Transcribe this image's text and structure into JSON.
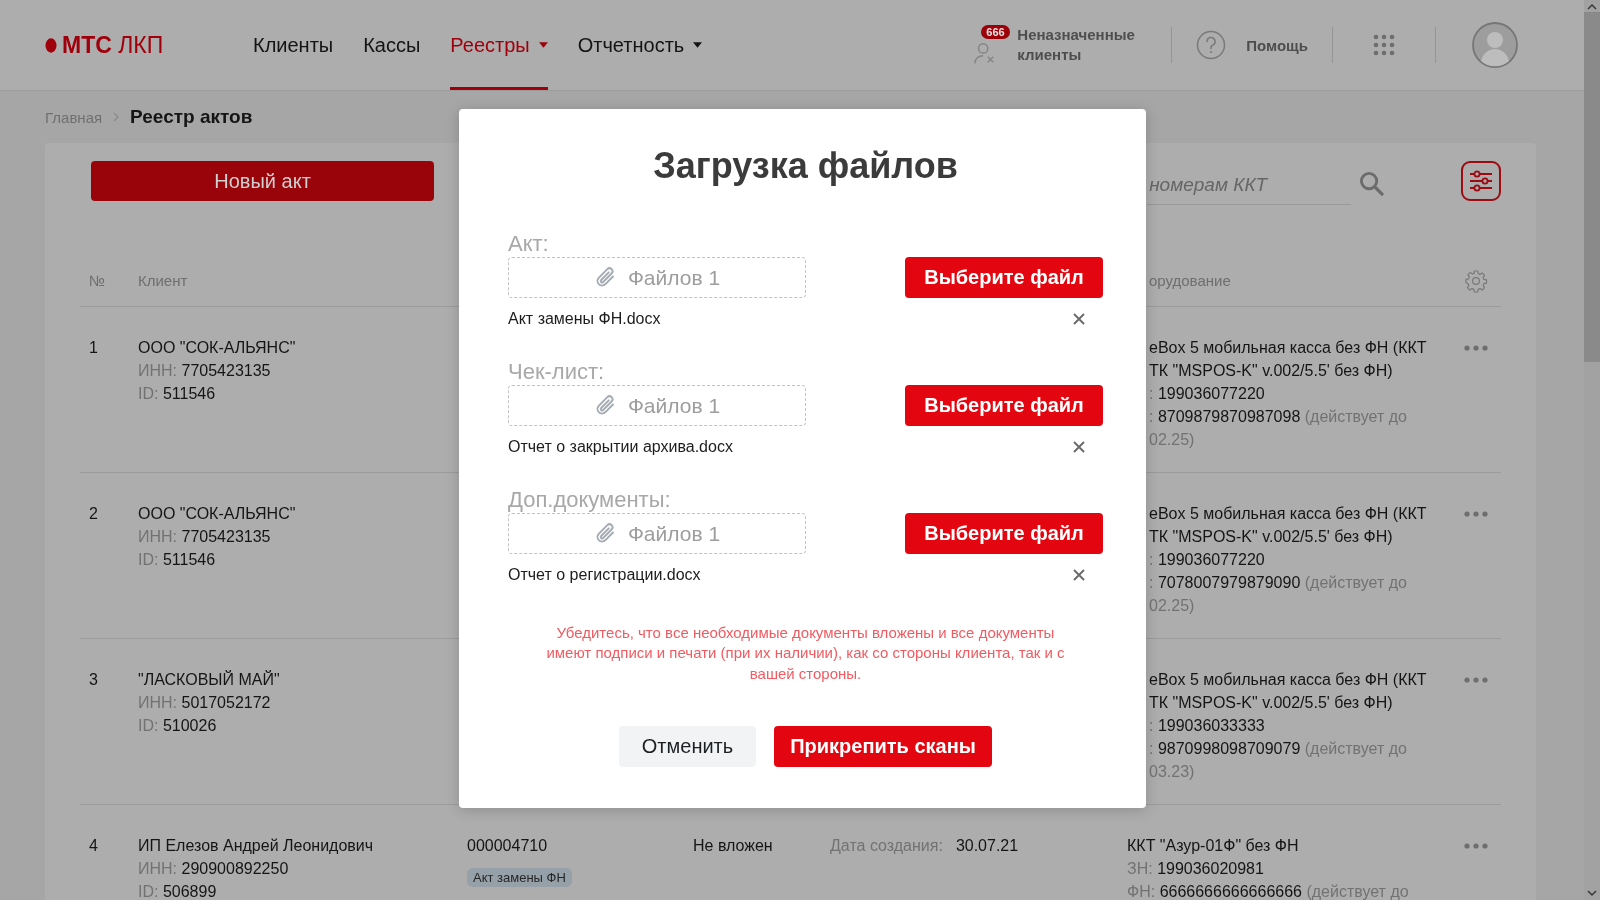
{
  "header": {
    "logo": {
      "brand": "МТС",
      "product": "ЛКП"
    },
    "nav": [
      {
        "label": "Клиенты",
        "selected": false,
        "has_menu": false
      },
      {
        "label": "Кассы",
        "selected": false,
        "has_menu": false
      },
      {
        "label": "Реестры",
        "selected": true,
        "has_menu": true
      },
      {
        "label": "Отчетность",
        "selected": false,
        "has_menu": true
      }
    ],
    "unassigned": {
      "badge": "666",
      "label": "Неназначенные клиенты"
    },
    "help": {
      "label": "Помощь"
    }
  },
  "breadcrumb": {
    "parent": "Главная",
    "current": "Реестр актов"
  },
  "toolbar": {
    "new_button": "Новый акт",
    "search": {
      "placeholder": "номерам ККТ"
    }
  },
  "table": {
    "columns": [
      {
        "kind": "number",
        "label": "№"
      },
      {
        "kind": "client",
        "label": "Клиент"
      },
      {
        "kind": "equipment",
        "label": "орудование"
      }
    ],
    "rows": [
      {
        "index": "1",
        "client": {
          "name": "ООО \"СОК-АЛЬЯНС\"",
          "inn_label": "ИНН:",
          "inn": "7705423135",
          "id_label": "ID:",
          "id": "511546"
        },
        "equipment": [
          [
            {
              "kind": "value",
              "text": "eBox 5 мобильная касса без ФН (ККТ"
            }
          ],
          [
            {
              "kind": "value",
              "text": "ТК \"MSPOS-K\" v.002/5.5' без ФН)"
            }
          ],
          [
            {
              "kind": "label",
              "text": ":"
            },
            {
              "kind": "value",
              "text": "199036077220"
            }
          ],
          [
            {
              "kind": "label",
              "text": ":"
            },
            {
              "kind": "value",
              "text": "8709879870987098"
            },
            {
              "kind": "label",
              "text": "(действует до"
            }
          ],
          [
            {
              "kind": "label",
              "text": "02.25)"
            }
          ]
        ]
      },
      {
        "index": "2",
        "client": {
          "name": "ООО \"СОК-АЛЬЯНС\"",
          "inn_label": "ИНН:",
          "inn": "7705423135",
          "id_label": "ID:",
          "id": "511546"
        },
        "equipment": [
          [
            {
              "kind": "value",
              "text": "eBox 5 мобильная касса без ФН (ККТ"
            }
          ],
          [
            {
              "kind": "value",
              "text": "ТК \"MSPOS-K\" v.002/5.5' без ФН)"
            }
          ],
          [
            {
              "kind": "label",
              "text": ":"
            },
            {
              "kind": "value",
              "text": "199036077220"
            }
          ],
          [
            {
              "kind": "label",
              "text": ":"
            },
            {
              "kind": "value",
              "text": "7078007979879090"
            },
            {
              "kind": "label",
              "text": "(действует до"
            }
          ],
          [
            {
              "kind": "label",
              "text": "02.25)"
            }
          ]
        ]
      },
      {
        "index": "3",
        "client": {
          "name": "\"ЛАСКОВЫЙ МАЙ\"",
          "inn_label": "ИНН:",
          "inn": "5017052172",
          "id_label": "ID:",
          "id": "510026"
        },
        "equipment": [
          [
            {
              "kind": "value",
              "text": "eBox 5 мобильная касса без ФН (ККТ"
            }
          ],
          [
            {
              "kind": "value",
              "text": "ТК \"MSPOS-K\" v.002/5.5' без ФН)"
            }
          ],
          [
            {
              "kind": "label",
              "text": ":"
            },
            {
              "kind": "value",
              "text": "199036033333"
            }
          ],
          [
            {
              "kind": "label",
              "text": ":"
            },
            {
              "kind": "value",
              "text": "9870998098709079"
            },
            {
              "kind": "label",
              "text": "(действует до"
            }
          ],
          [
            {
              "kind": "label",
              "text": "03.23)"
            }
          ]
        ]
      },
      {
        "index": "4",
        "client": {
          "name": "ИП Елезов Андрей Леонидович",
          "inn_label": "ИНН:",
          "inn": "290900892250",
          "id_label": "ID:",
          "id": "506899"
        },
        "act_number": "000004710",
        "tag": "Акт замены ФН",
        "status": "Не вложен",
        "date_label": "Дата создания:",
        "date": "30.07.21",
        "equipment": [
          [
            {
              "kind": "value",
              "text": "ККТ \"Азур-01Ф\" без ФН"
            }
          ],
          [
            {
              "kind": "label",
              "text": "ЗН:"
            },
            {
              "kind": "value",
              "text": "199036020981"
            }
          ],
          [
            {
              "kind": "label",
              "text": "ФН:"
            },
            {
              "kind": "value",
              "text": "6666666666666666"
            },
            {
              "kind": "label",
              "text": "(действует до"
            }
          ]
        ]
      }
    ]
  },
  "modal": {
    "title": "Загрузка файлов",
    "sections": [
      {
        "label": "Акт:",
        "dropzone": "Файлов 1",
        "button": "Выберите файл",
        "files": [
          "Акт замены ФН.docx"
        ]
      },
      {
        "label": "Чек-лист:",
        "dropzone": "Файлов 1",
        "button": "Выберите файл",
        "files": [
          "Отчет о закрытии архива.docx"
        ]
      },
      {
        "label": "Доп.документы:",
        "dropzone": "Файлов 1",
        "button": "Выберите файл",
        "files": [
          "Отчет о регистрации.docx"
        ]
      }
    ],
    "warning": "Убедитесь, что все необходимые документы вложены и все документы имеют подписи и печати (при их наличии), как со стороны клиента, так и с вашей стороны.",
    "buttons": [
      {
        "kind": "secondary",
        "label": "Отменить"
      },
      {
        "kind": "primary",
        "label": "Прикрепить сканы"
      }
    ]
  }
}
